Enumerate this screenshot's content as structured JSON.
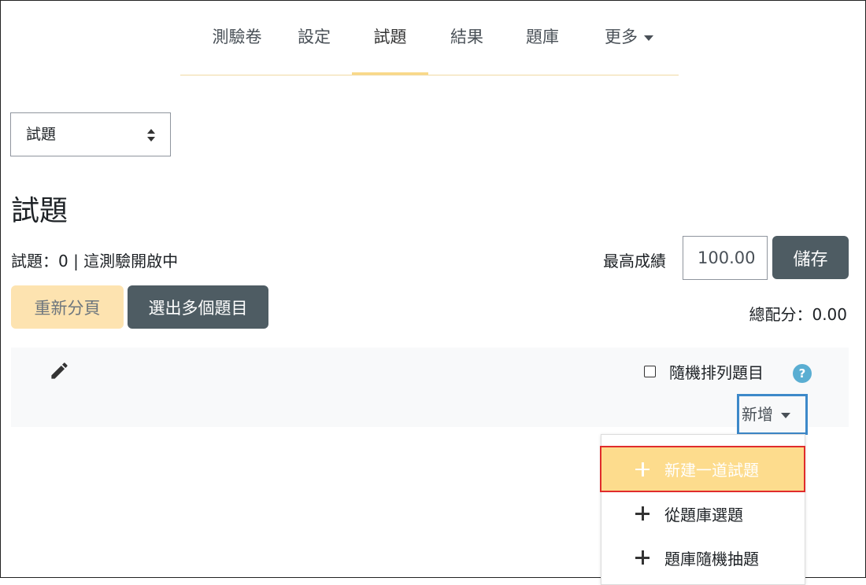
{
  "nav": {
    "tabs": [
      {
        "label": "測驗卷"
      },
      {
        "label": "設定"
      },
      {
        "label": "試題"
      },
      {
        "label": "結果"
      },
      {
        "label": "題庫"
      },
      {
        "label": "更多"
      }
    ],
    "active": "試題"
  },
  "select": {
    "value": "試題"
  },
  "page": {
    "heading": "試題",
    "info": "試題：0 | 這測驗開啟中"
  },
  "grade": {
    "label": "最高成績",
    "value": "100.00",
    "save": "儲存",
    "total": "總配分：0.00"
  },
  "buttons": {
    "repaginate": "重新分頁",
    "select_multiple": "選出多個題目"
  },
  "section": {
    "shuffle_label": "隨機排列題目",
    "help": "?",
    "add_label": "新增"
  },
  "add_menu": {
    "items": [
      {
        "label": "新建一道試題"
      },
      {
        "label": "從題庫選題"
      },
      {
        "label": "題庫隨機抽題"
      }
    ]
  },
  "colors": {
    "accent": "#f9d989",
    "dark_button": "#4e5c63",
    "help_icon": "#5aaed2",
    "focus_border": "#3d89c9",
    "highlight_border": "#e02c2c"
  }
}
